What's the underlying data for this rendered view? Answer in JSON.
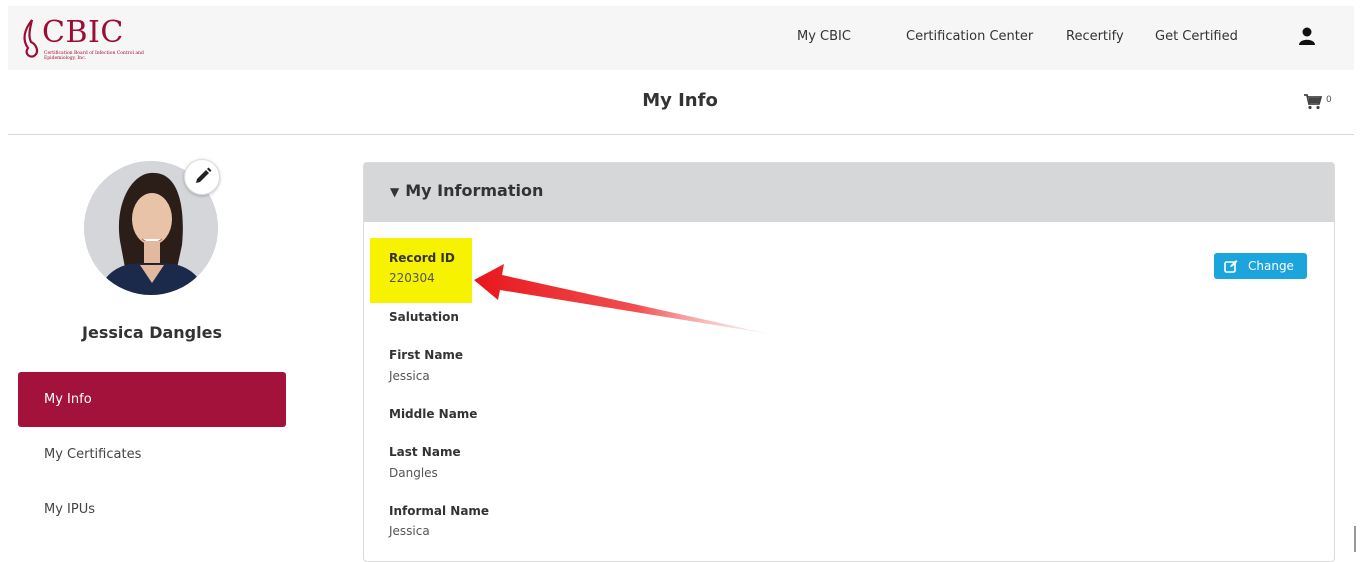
{
  "header": {
    "logo_text": "CBIC",
    "logo_tagline": "Certification Board of Infection Control and Epidemiology, Inc.",
    "nav": [
      "My CBIC",
      "Certification Center",
      "Recertify",
      "Get Certified"
    ],
    "user_icon": "user-icon"
  },
  "page": {
    "title": "My Info",
    "cart_count": "0",
    "cart_icon": "cart-icon"
  },
  "sidebar": {
    "profile_name": "Jessica Dangles",
    "edit_icon": "pencil-icon",
    "items": [
      {
        "label": "My Info",
        "active": true
      },
      {
        "label": "My Certificates",
        "active": false
      },
      {
        "label": "My IPUs",
        "active": false
      }
    ]
  },
  "panel": {
    "title": "My Information",
    "change_label": "Change",
    "fields": [
      {
        "label": "Record ID",
        "value": "220304"
      },
      {
        "label": "Salutation",
        "value": ""
      },
      {
        "label": "First Name",
        "value": "Jessica"
      },
      {
        "label": "Middle Name",
        "value": ""
      },
      {
        "label": "Last Name",
        "value": "Dangles"
      },
      {
        "label": "Informal Name",
        "value": "Jessica"
      }
    ]
  },
  "colors": {
    "brand": "#a3123a",
    "accent_button": "#1ca4dc",
    "highlight": "#f7f200",
    "arrow": "#e8161b"
  }
}
